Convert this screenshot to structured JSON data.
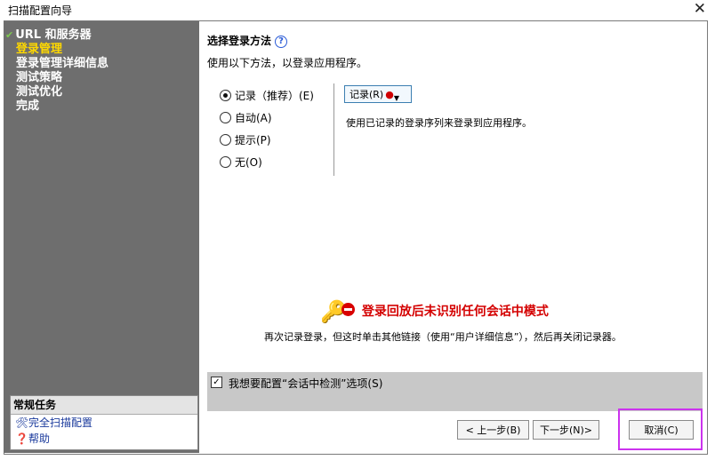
{
  "window": {
    "title": "扫描配置向导",
    "close": "✕"
  },
  "sidebar": {
    "steps": [
      {
        "label": "URL 和服务器",
        "state": "done"
      },
      {
        "label": "登录管理",
        "state": "active"
      },
      {
        "label": "登录管理详细信息",
        "state": "pending"
      },
      {
        "label": "测试策略",
        "state": "pending"
      },
      {
        "label": "测试优化",
        "state": "pending"
      },
      {
        "label": "完成",
        "state": "pending"
      }
    ],
    "tasks": {
      "header": "常规任务",
      "items": [
        {
          "label": "完全扫描配置"
        },
        {
          "label": "帮助"
        }
      ]
    }
  },
  "main": {
    "title": "选择登录方法",
    "help": "?",
    "description": "使用以下方法，以登录应用程序。",
    "methods": [
      {
        "label": "记录（推荐）(E)",
        "selected": true
      },
      {
        "label": "自动(A)",
        "selected": false
      },
      {
        "label": "提示(P)",
        "selected": false
      },
      {
        "label": "无(O)",
        "selected": false
      }
    ],
    "record_button": "记录(R)",
    "record_description": "使用已记录的登录序列来登录到应用程序。",
    "warning": {
      "title": "登录回放后未识别任何会话中模式",
      "detail": "再次记录登录，但这时单击其他链接（使用“用户详细信息”），然后再关闭记录器。"
    },
    "option": {
      "label": "我想要配置“会话中检测”选项(S)",
      "checked": true
    }
  },
  "footer": {
    "back": "< 上一步(B)",
    "next": "下一步(N)>",
    "cancel": "取消(C)"
  },
  "colors": {
    "sidebar_bg": "#6e6e6e",
    "active_step": "#ffd800",
    "warning": "#d40000",
    "highlight": "#cc33ee"
  }
}
